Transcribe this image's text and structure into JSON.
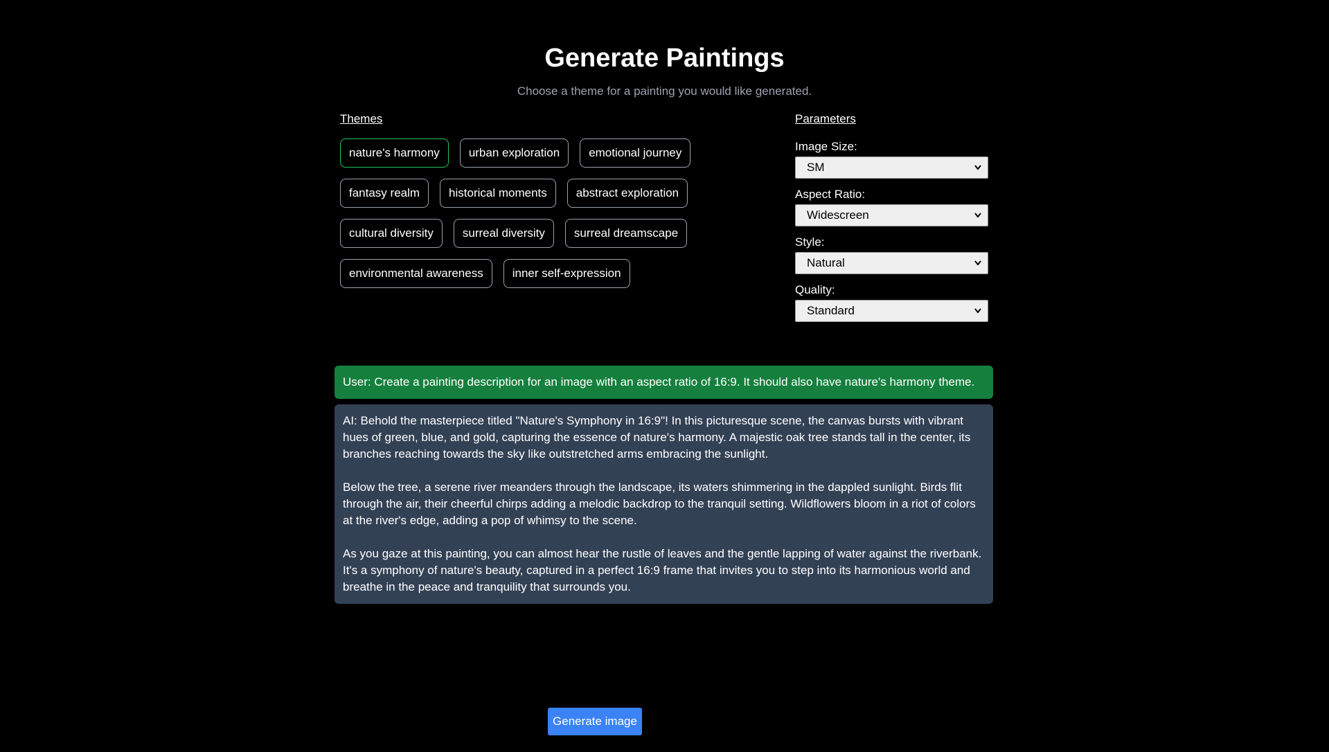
{
  "header": {
    "title": "Generate Paintings",
    "subtitle": "Choose a theme for a painting you would like generated."
  },
  "themes": {
    "heading": "Themes",
    "selected": "nature's harmony",
    "items": [
      {
        "label": "nature's harmony"
      },
      {
        "label": "urban exploration"
      },
      {
        "label": "emotional journey"
      },
      {
        "label": "fantasy realm"
      },
      {
        "label": "historical moments"
      },
      {
        "label": "abstract exploration"
      },
      {
        "label": "cultural diversity"
      },
      {
        "label": "surreal diversity"
      },
      {
        "label": "surreal dreamscape"
      },
      {
        "label": "environmental awareness"
      },
      {
        "label": "inner self-expression"
      }
    ]
  },
  "parameters": {
    "heading": "Parameters",
    "image_size": {
      "label": "Image Size:",
      "value": "SM"
    },
    "aspect_ratio": {
      "label": "Aspect Ratio:",
      "value": "Widescreen"
    },
    "style": {
      "label": "Style:",
      "value": "Natural"
    },
    "quality": {
      "label": "Quality:",
      "value": "Standard"
    }
  },
  "conversation": {
    "user_message": "User: Create a painting description for an image with an aspect ratio of 16:9. It should also have nature's harmony theme.",
    "ai_paragraphs": [
      "AI: Behold the masterpiece titled \"Nature's Symphony in 16:9\"! In this picturesque scene, the canvas bursts with vibrant hues of green, blue, and gold, capturing the essence of nature's harmony. A majestic oak tree stands tall in the center, its branches reaching towards the sky like outstretched arms embracing the sunlight.",
      "Below the tree, a serene river meanders through the landscape, its waters shimmering in the dappled sunlight. Birds flit through the air, their cheerful chirps adding a melodic backdrop to the tranquil setting. Wildflowers bloom in a riot of colors at the river's edge, adding a pop of whimsy to the scene.",
      "As you gaze at this painting, you can almost hear the rustle of leaves and the gentle lapping of water against the riverbank. It's a symphony of nature's beauty, captured in a perfect 16:9 frame that invites you to step into its harmonious world and breathe in the peace and tranquility that surrounds you."
    ]
  },
  "actions": {
    "generate_label": "Generate image"
  },
  "colors": {
    "background": "#000000",
    "selected_border": "#22c55e",
    "user_bubble": "#15803d",
    "ai_bubble": "#334155",
    "primary_button": "#3b82f6"
  },
  "icons": {
    "select_arrow": "chevron-down-icon"
  }
}
